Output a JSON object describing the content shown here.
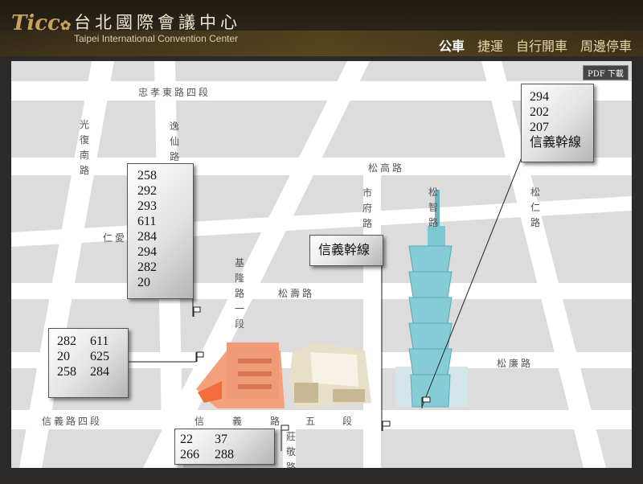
{
  "header": {
    "logo_text": "Ticc",
    "name_cn": "台北國際會議中心",
    "name_en": "Taipei International Convention Center",
    "nav": [
      "公車",
      "捷運",
      "自行開車",
      "周邊停車"
    ],
    "active_nav": "公車",
    "colors": {
      "logo": "#c9a25a",
      "header_bg": "#2a2418",
      "nav_text": "#e8d5a8"
    }
  },
  "map": {
    "pdf_button": "PDF 下載",
    "roads": {
      "zhongxiao": "忠孝東路四段",
      "guangfu": "光復南路",
      "yixian": "逸仙路",
      "songgao": "松高路",
      "shifu": "市府路",
      "songzhi": "松智路",
      "songren": "松仁路",
      "renai": "仁愛",
      "keelung": "基隆路一段",
      "songshou": "松壽路",
      "songlian": "松廉路",
      "xinyi4": "信義路四段",
      "xinyi5": [
        "信",
        "義",
        "路",
        "五",
        "段"
      ],
      "zhuangjing": "莊敬路"
    },
    "bus_stops": {
      "keelung_north": [
        "258",
        "292",
        "293",
        "611",
        "284",
        "294",
        "282",
        "20"
      ],
      "keelung_south": {
        "col1": [
          "282",
          "20",
          "258"
        ],
        "col2": [
          "611",
          "625",
          "284"
        ]
      },
      "xinyi_zhuangjing": {
        "col1": [
          "22",
          "266"
        ],
        "col2": [
          "37",
          "288"
        ]
      },
      "xinyi_trunk": [
        "信義幹線"
      ],
      "taipei101": [
        "294",
        "202",
        "207",
        "信義幹線"
      ]
    }
  }
}
